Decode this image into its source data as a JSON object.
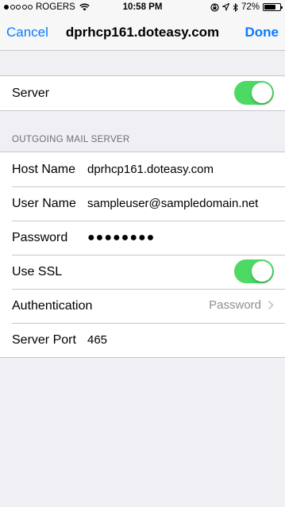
{
  "status_bar": {
    "carrier": "ROGERS",
    "time": "10:58 PM",
    "battery_percent": "72%",
    "battery_level": 0.72,
    "signal_dots_filled": 1,
    "signal_dots_total": 5
  },
  "nav": {
    "cancel_label": "Cancel",
    "title": "dprhcp161.doteasy.com",
    "done_label": "Done"
  },
  "server_group": {
    "server_label": "Server",
    "server_enabled": true
  },
  "outgoing": {
    "section_header": "OUTGOING MAIL SERVER",
    "host_name_label": "Host Name",
    "host_name_value": "dprhcp161.doteasy.com",
    "user_name_label": "User Name",
    "user_name_value": "sampleuser@sampledomain.net",
    "password_label": "Password",
    "password_value": "●●●●●●●●",
    "use_ssl_label": "Use SSL",
    "use_ssl_enabled": true,
    "authentication_label": "Authentication",
    "authentication_value": "Password",
    "server_port_label": "Server Port",
    "server_port_value": "465"
  },
  "colors": {
    "accent": "#0a7aff",
    "toggle_on": "#4cd964",
    "background": "#efeff4",
    "secondary_text": "#8e8e93"
  },
  "icons": [
    "wifi-icon",
    "lock-rotation-icon",
    "location-arrow-icon",
    "bluetooth-icon",
    "battery-icon",
    "chevron-right-icon"
  ]
}
